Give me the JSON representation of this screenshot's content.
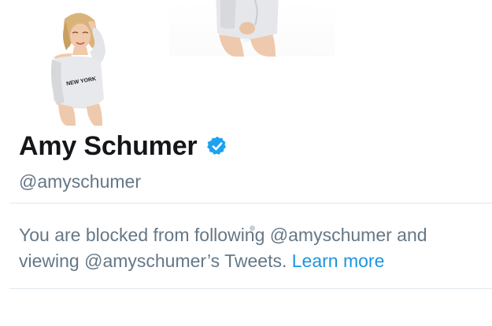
{
  "profile": {
    "display_name": "Amy Schumer",
    "handle": "@amyschumer",
    "verified": true,
    "avatar_shirt_text": "NEW YORK"
  },
  "blocked": {
    "message": "You are blocked from following @amyschumer and viewing @amyschumer’s Tweets.",
    "link_label": "Learn more"
  },
  "icons": {
    "verified": "verified-badge-icon"
  },
  "colors": {
    "name": "#14171a",
    "secondary_text": "#657786",
    "link": "#1b95e0",
    "verified": "#1da1f2",
    "divider": "#e1e8ed"
  }
}
